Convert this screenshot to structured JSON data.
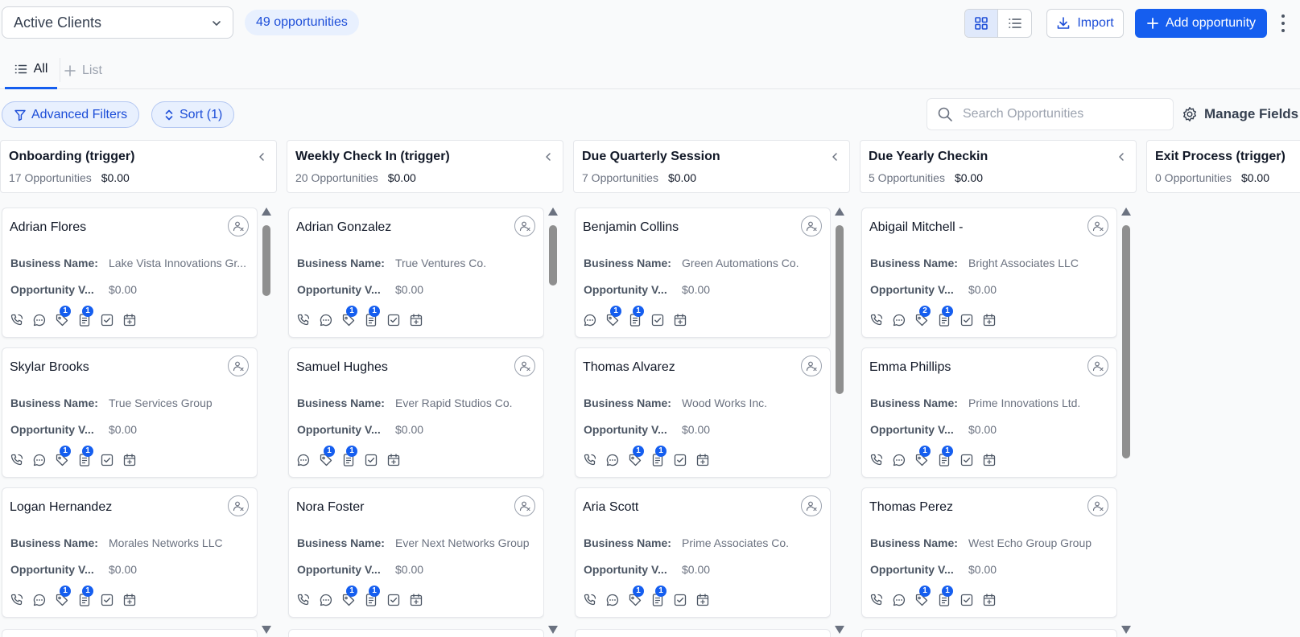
{
  "header": {
    "pipeline": "Active Clients",
    "opportunity_count": "49 opportunities",
    "import_label": "Import",
    "add_label": "Add opportunity"
  },
  "tabs": {
    "all_label": "All",
    "list_label": "List"
  },
  "filters": {
    "advanced_label": "Advanced Filters",
    "sort_label": "Sort (1)",
    "search_placeholder": "Search Opportunities",
    "manage_fields_label": "Manage Fields"
  },
  "labels": {
    "business_name": "Business Name:",
    "opportunity_value": "Opportunity V..."
  },
  "colors": {
    "accent": "#155eef",
    "accent_light": "#e8f0fe"
  },
  "columns": [
    {
      "title": "Onboarding (trigger)",
      "count": "17 Opportunities",
      "amount": "$0.00",
      "cards": [
        {
          "name": "Adrian Flores",
          "business": "Lake Vista Innovations Gr...",
          "value": "$0.00",
          "actions": [
            {
              "icon": "phone-icon"
            },
            {
              "icon": "chat-icon"
            },
            {
              "icon": "tag-icon",
              "badge": "1"
            },
            {
              "icon": "note-icon",
              "badge": "1"
            },
            {
              "icon": "task-icon"
            },
            {
              "icon": "calendar-icon"
            }
          ]
        },
        {
          "name": "Skylar Brooks",
          "business": "True Services Group",
          "value": "$0.00",
          "actions": [
            {
              "icon": "phone-icon"
            },
            {
              "icon": "chat-icon"
            },
            {
              "icon": "tag-icon",
              "badge": "1"
            },
            {
              "icon": "note-icon",
              "badge": "1"
            },
            {
              "icon": "task-icon"
            },
            {
              "icon": "calendar-icon"
            }
          ]
        },
        {
          "name": "Logan Hernandez",
          "business": "Morales Networks LLC",
          "value": "$0.00",
          "actions": [
            {
              "icon": "phone-icon"
            },
            {
              "icon": "chat-icon"
            },
            {
              "icon": "tag-icon",
              "badge": "1"
            },
            {
              "icon": "note-icon",
              "badge": "1"
            },
            {
              "icon": "task-icon"
            },
            {
              "icon": "calendar-icon"
            }
          ]
        }
      ]
    },
    {
      "title": "Weekly Check In (trigger)",
      "count": "20 Opportunities",
      "amount": "$0.00",
      "cards": [
        {
          "name": "Adrian Gonzalez",
          "business": "True Ventures Co.",
          "value": "$0.00",
          "actions": [
            {
              "icon": "phone-icon"
            },
            {
              "icon": "chat-icon"
            },
            {
              "icon": "tag-icon",
              "badge": "1"
            },
            {
              "icon": "note-icon",
              "badge": "1"
            },
            {
              "icon": "task-icon"
            },
            {
              "icon": "calendar-icon"
            }
          ]
        },
        {
          "name": "Samuel Hughes",
          "business": "Ever Rapid Studios Co.",
          "value": "$0.00",
          "actions": [
            {
              "icon": "chat-icon"
            },
            {
              "icon": "tag-icon",
              "badge": "1"
            },
            {
              "icon": "note-icon",
              "badge": "1"
            },
            {
              "icon": "task-icon"
            },
            {
              "icon": "calendar-icon"
            }
          ]
        },
        {
          "name": "Nora Foster",
          "business": "Ever Next Networks Group",
          "value": "$0.00",
          "actions": [
            {
              "icon": "phone-icon"
            },
            {
              "icon": "chat-icon"
            },
            {
              "icon": "tag-icon",
              "badge": "1"
            },
            {
              "icon": "note-icon",
              "badge": "1"
            },
            {
              "icon": "task-icon"
            },
            {
              "icon": "calendar-icon"
            }
          ]
        }
      ]
    },
    {
      "title": "Due Quarterly Session",
      "count": "7 Opportunities",
      "amount": "$0.00",
      "cards": [
        {
          "name": "Benjamin Collins",
          "business": "Green Automations Co.",
          "value": "$0.00",
          "actions": [
            {
              "icon": "chat-icon"
            },
            {
              "icon": "tag-icon",
              "badge": "1"
            },
            {
              "icon": "note-icon",
              "badge": "1"
            },
            {
              "icon": "task-icon"
            },
            {
              "icon": "calendar-icon"
            }
          ]
        },
        {
          "name": "Thomas Alvarez",
          "business": "Wood Works Inc.",
          "value": "$0.00",
          "actions": [
            {
              "icon": "phone-icon"
            },
            {
              "icon": "chat-icon"
            },
            {
              "icon": "tag-icon",
              "badge": "1"
            },
            {
              "icon": "note-icon",
              "badge": "1"
            },
            {
              "icon": "task-icon"
            },
            {
              "icon": "calendar-icon"
            }
          ]
        },
        {
          "name": "Aria Scott",
          "business": "Prime Associates Co.",
          "value": "$0.00",
          "actions": [
            {
              "icon": "phone-icon"
            },
            {
              "icon": "chat-icon"
            },
            {
              "icon": "tag-icon",
              "badge": "1"
            },
            {
              "icon": "note-icon",
              "badge": "1"
            },
            {
              "icon": "task-icon"
            },
            {
              "icon": "calendar-icon"
            }
          ]
        }
      ]
    },
    {
      "title": "Due Yearly Checkin",
      "count": "5 Opportunities",
      "amount": "$0.00",
      "cards": [
        {
          "name": "Abigail Mitchell -",
          "business": "Bright Associates LLC",
          "value": "$0.00",
          "actions": [
            {
              "icon": "phone-icon"
            },
            {
              "icon": "chat-icon"
            },
            {
              "icon": "tag-icon",
              "badge": "2"
            },
            {
              "icon": "note-icon",
              "badge": "1"
            },
            {
              "icon": "task-icon"
            },
            {
              "icon": "calendar-icon"
            }
          ]
        },
        {
          "name": "Emma Phillips",
          "business": "Prime Innovations Ltd.",
          "value": "$0.00",
          "actions": [
            {
              "icon": "phone-icon"
            },
            {
              "icon": "chat-icon"
            },
            {
              "icon": "tag-icon",
              "badge": "1"
            },
            {
              "icon": "note-icon",
              "badge": "1"
            },
            {
              "icon": "task-icon"
            },
            {
              "icon": "calendar-icon"
            }
          ]
        },
        {
          "name": "Thomas Perez",
          "business": "West Echo Group Group",
          "value": "$0.00",
          "actions": [
            {
              "icon": "phone-icon"
            },
            {
              "icon": "chat-icon"
            },
            {
              "icon": "tag-icon",
              "badge": "1"
            },
            {
              "icon": "note-icon",
              "badge": "1"
            },
            {
              "icon": "task-icon"
            },
            {
              "icon": "calendar-icon"
            }
          ]
        }
      ]
    },
    {
      "title": "Exit Process (trigger)",
      "count": "0 Opportunities",
      "amount": "$0.00",
      "cards": []
    }
  ]
}
